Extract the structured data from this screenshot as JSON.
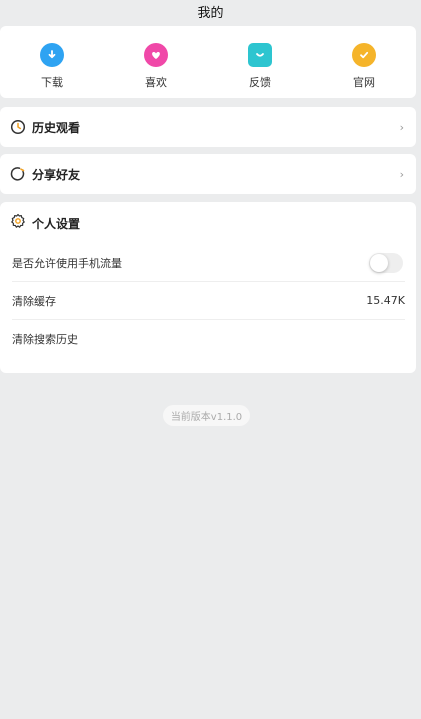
{
  "header": {
    "title": "我的"
  },
  "quick_actions": [
    {
      "label": "下载",
      "icon": "download-icon",
      "color": "#2ea3f2"
    },
    {
      "label": "喜欢",
      "icon": "heart-icon",
      "color": "#f048a8"
    },
    {
      "label": "反馈",
      "icon": "feedback-icon",
      "color": "#2dc5d0"
    },
    {
      "label": "官网",
      "icon": "website-icon",
      "color": "#f5b42a"
    }
  ],
  "history": {
    "title": "历史观看",
    "chevron": "›"
  },
  "share": {
    "title": "分享好友",
    "chevron": "›"
  },
  "settings": {
    "title": "个人设置",
    "mobile_data": {
      "label": "是否允许使用手机流量",
      "enabled": false
    },
    "clear_cache": {
      "label": "清除缓存",
      "value": "15.47K"
    },
    "clear_search": {
      "label": "清除搜索历史"
    }
  },
  "version": "当前版本v1.1.0"
}
